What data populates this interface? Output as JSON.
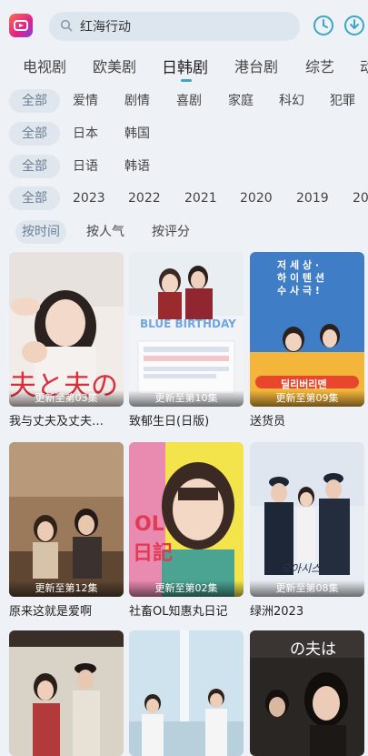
{
  "header": {
    "search_text": "红海行动",
    "icons": [
      "logo-icon",
      "search-icon",
      "history-icon",
      "download-icon"
    ]
  },
  "tabs": [
    {
      "label": "电视剧"
    },
    {
      "label": "欧美剧"
    },
    {
      "label": "日韩剧",
      "active": true
    },
    {
      "label": "港台剧"
    },
    {
      "label": "综艺"
    },
    {
      "label": "动"
    }
  ],
  "filters": {
    "genre": [
      "全部",
      "爱情",
      "剧情",
      "喜剧",
      "家庭",
      "科幻",
      "犯罪"
    ],
    "region": [
      "全部",
      "日本",
      "韩国"
    ],
    "language": [
      "全部",
      "日语",
      "韩语"
    ],
    "year": [
      "全部",
      "2023",
      "2022",
      "2021",
      "2020",
      "2019",
      "20"
    ],
    "sort": [
      "按时间",
      "按人气",
      "按评分"
    ]
  },
  "cards": [
    {
      "title": "我与丈夫及丈夫…",
      "badge": "更新至第03集"
    },
    {
      "title": "致郁生日(日版)",
      "badge": "更新至第10集"
    },
    {
      "title": "送货员",
      "badge": "更新至第09集"
    },
    {
      "title": "原来这就是爱啊",
      "badge": "更新至第12集"
    },
    {
      "title": "社畜OL知惠丸日记",
      "badge": "更新至第02集"
    },
    {
      "title": "绿洲2023",
      "badge": "更新至第08集"
    },
    {
      "title": "",
      "badge": ""
    },
    {
      "title": "",
      "badge": ""
    },
    {
      "title": "",
      "badge": ""
    }
  ],
  "poster_text": {
    "p1": "夫と夫の",
    "p2": "BLUE BIRTHDAY",
    "p3_line1": "저 세 상 ·",
    "p3_line2": "하 이 텐 션",
    "p3_line3": "수 사 극 !",
    "p3_title": "딜리버리맨",
    "p5_line1": "OL",
    "p5_line2": "日記",
    "p6": "오아시스",
    "p9": "の夫は"
  },
  "colors": {
    "accent": "#3aa6c9",
    "background": "#eef1f6",
    "chip_selected_bg": "#e0e6ee",
    "search_bg": "#dde5ee"
  }
}
